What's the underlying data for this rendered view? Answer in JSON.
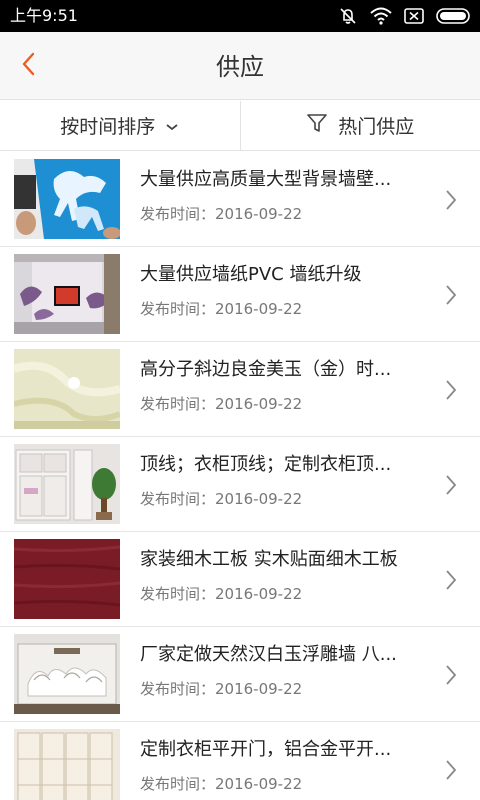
{
  "status_bar": {
    "time": "上午9:51",
    "icons": [
      "mute-icon",
      "wifi-icon",
      "close-box-icon",
      "battery-icon"
    ]
  },
  "header": {
    "back_icon": "chevron-left-icon",
    "title": "供应"
  },
  "filters": {
    "sort_label": "按时间排序",
    "hot_label": "热门供应"
  },
  "colors": {
    "accent": "#f15a24",
    "status_bar_bg": "#000000",
    "header_bg": "#f7f7f7"
  },
  "items": [
    {
      "title": "大量供应高质量大型背景墙壁...",
      "date_label": "发布时间：2016-09-22",
      "thumb": "blue-horse-painting"
    },
    {
      "title": "大量供应墙纸PVC 墙纸升级",
      "date_label": "发布时间：2016-09-22",
      "thumb": "tv-wall-wallpaper"
    },
    {
      "title": "高分子斜边良金美玉（金）时...",
      "date_label": "发布时间：2016-09-22",
      "thumb": "jade-tile"
    },
    {
      "title": "顶线；衣柜顶线；定制衣柜顶...",
      "date_label": "发布时间：2016-09-22",
      "thumb": "wardrobe-cabinet"
    },
    {
      "title": "家装细木工板 实木贴面细木工板",
      "date_label": "发布时间：2016-09-22",
      "thumb": "wood-veneer-board"
    },
    {
      "title": "厂家定做天然汉白玉浮雕墙 八...",
      "date_label": "发布时间：2016-09-22",
      "thumb": "marble-relief-horses"
    },
    {
      "title": "定制衣柜平开门，铝合金平开...",
      "date_label": "发布时间：2016-09-22",
      "thumb": "wardrobe-door"
    }
  ]
}
